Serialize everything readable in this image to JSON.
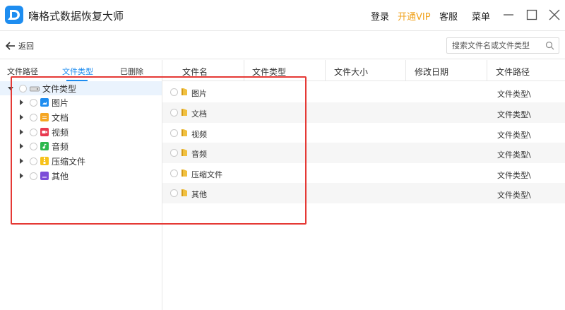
{
  "app": {
    "title": "嗨格式数据恢复大师",
    "logo_letter": "D",
    "colors": {
      "accent": "#1e8df0",
      "vip": "#f0a21c",
      "highlight": "#e53935"
    }
  },
  "top_menu": {
    "login": "登录",
    "vip": "开通VIP",
    "service": "客服",
    "menu": "菜单"
  },
  "window_controls": [
    "minimize-icon",
    "maximize-icon",
    "close-icon"
  ],
  "toolbar": {
    "back_label": "返回",
    "search_placeholder": "搜索文件名或文件类型"
  },
  "left_tabs": [
    {
      "label": "文件路径",
      "active": false
    },
    {
      "label": "文件类型",
      "active": true
    },
    {
      "label": "已删除",
      "active": false
    }
  ],
  "tree": {
    "root": {
      "label": "文件类型",
      "icon": "drive-icon",
      "expanded": true
    },
    "children": [
      {
        "label": "图片",
        "icon": "image-icon",
        "color": "#1e8df0"
      },
      {
        "label": "文档",
        "icon": "document-icon",
        "color": "#f5a623"
      },
      {
        "label": "视频",
        "icon": "video-icon",
        "color": "#e8394f"
      },
      {
        "label": "音频",
        "icon": "audio-icon",
        "color": "#2db84d"
      },
      {
        "label": "压缩文件",
        "icon": "archive-icon",
        "color": "#f7c21b"
      },
      {
        "label": "其他",
        "icon": "other-icon",
        "color": "#7c4dd8"
      }
    ]
  },
  "columns": [
    "文件名",
    "文件类型",
    "文件大小",
    "修改日期",
    "文件路径"
  ],
  "rows": [
    {
      "name": "图片",
      "path": "文件类型\\"
    },
    {
      "name": "文档",
      "path": "文件类型\\"
    },
    {
      "name": "视频",
      "path": "文件类型\\"
    },
    {
      "name": "音频",
      "path": "文件类型\\"
    },
    {
      "name": "压缩文件",
      "path": "文件类型\\"
    },
    {
      "name": "其他",
      "path": "文件类型\\"
    }
  ]
}
